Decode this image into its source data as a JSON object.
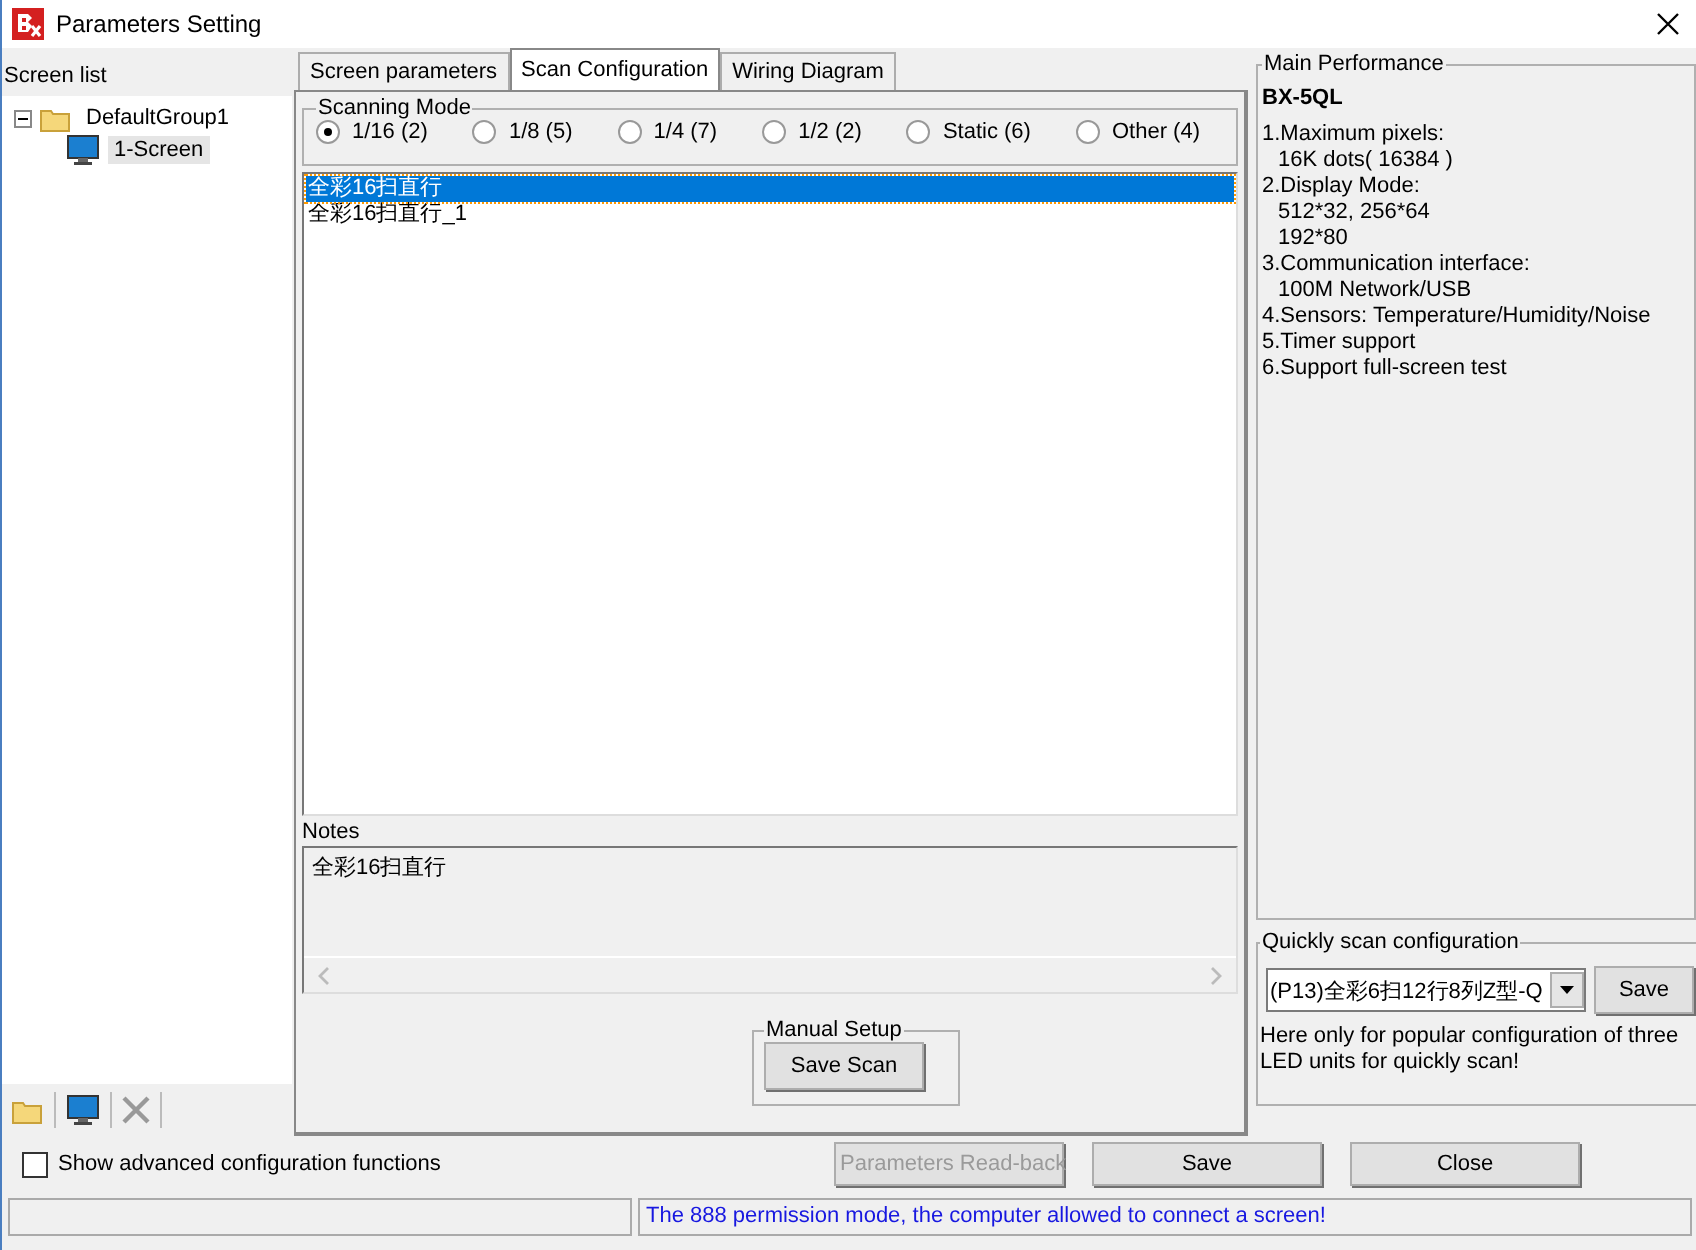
{
  "window": {
    "title": "Parameters Setting"
  },
  "screen_list": {
    "title": "Screen list",
    "tree": [
      {
        "label": "DefaultGroup1",
        "expanded": true,
        "selected": false,
        "children": [
          {
            "label": "1-Screen",
            "selected": true
          }
        ]
      }
    ]
  },
  "tabs": [
    {
      "label": "Screen parameters",
      "selected": false
    },
    {
      "label": "Scan Configuration",
      "selected": true
    },
    {
      "label": "Wiring Diagram",
      "selected": false
    }
  ],
  "scanning_mode": {
    "title": "Scanning Mode",
    "options": [
      {
        "label": "1/16 (2)",
        "selected": true
      },
      {
        "label": "1/8 (5)",
        "selected": false
      },
      {
        "label": "1/4 (7)",
        "selected": false
      },
      {
        "label": "1/2 (2)",
        "selected": false
      },
      {
        "label": "Static (6)",
        "selected": false
      },
      {
        "label": "Other (4)",
        "selected": false
      }
    ]
  },
  "scan_list": [
    {
      "label": "全彩16扫直行",
      "selected": true
    },
    {
      "label": "全彩16扫直行_1",
      "selected": false
    }
  ],
  "notes": {
    "label": "Notes",
    "text": "全彩16扫直行"
  },
  "manual_setup": {
    "title": "Manual Setup",
    "button": "Save Scan"
  },
  "main_performance": {
    "title": "Main Performance",
    "model": "BX-5QL",
    "items": [
      {
        "title": "1.Maximum pixels:",
        "details": [
          "16K dots( 16384 )"
        ]
      },
      {
        "title": "2.Display Mode:",
        "details": [
          "512*32, 256*64",
          "192*80"
        ]
      },
      {
        "title": "3.Communication interface:",
        "details": [
          "100M Network/USB"
        ]
      },
      {
        "title": "4.Sensors: Temperature/Humidity/Noise"
      },
      {
        "title": "5.Timer support"
      },
      {
        "title": "6.Support full-screen test"
      }
    ]
  },
  "quick_scan": {
    "title": "Quickly scan configuration",
    "value": "(P13)全彩6扫12行8列Z型-Q",
    "button": "Save",
    "note": "Here only for popular configuration of three LED units for quickly scan!"
  },
  "advanced": {
    "label": "Show advanced configuration functions",
    "checked": false
  },
  "buttons": [
    {
      "label": "Parameters Read-back",
      "disabled": true
    },
    {
      "label": "Save",
      "disabled": false
    },
    {
      "label": "Close",
      "disabled": false
    }
  ],
  "status_bar": {
    "message": "The 888 permission mode, the computer allowed to connect a screen!"
  }
}
